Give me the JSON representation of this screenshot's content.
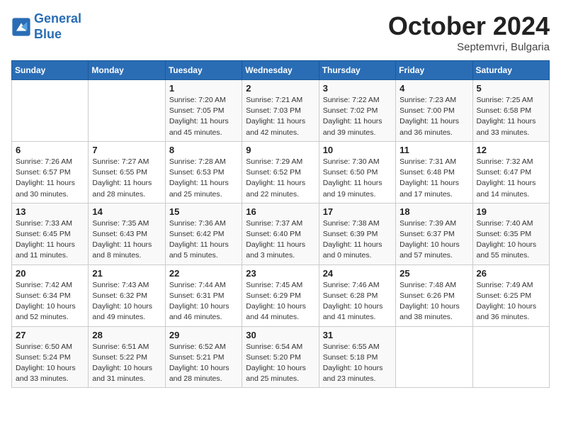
{
  "logo": {
    "line1": "General",
    "line2": "Blue"
  },
  "title": "October 2024",
  "subtitle": "Septemvri, Bulgaria",
  "weekdays": [
    "Sunday",
    "Monday",
    "Tuesday",
    "Wednesday",
    "Thursday",
    "Friday",
    "Saturday"
  ],
  "weeks": [
    [
      {
        "day": "",
        "info": ""
      },
      {
        "day": "",
        "info": ""
      },
      {
        "day": "1",
        "info": "Sunrise: 7:20 AM\nSunset: 7:05 PM\nDaylight: 11 hours and 45 minutes."
      },
      {
        "day": "2",
        "info": "Sunrise: 7:21 AM\nSunset: 7:03 PM\nDaylight: 11 hours and 42 minutes."
      },
      {
        "day": "3",
        "info": "Sunrise: 7:22 AM\nSunset: 7:02 PM\nDaylight: 11 hours and 39 minutes."
      },
      {
        "day": "4",
        "info": "Sunrise: 7:23 AM\nSunset: 7:00 PM\nDaylight: 11 hours and 36 minutes."
      },
      {
        "day": "5",
        "info": "Sunrise: 7:25 AM\nSunset: 6:58 PM\nDaylight: 11 hours and 33 minutes."
      }
    ],
    [
      {
        "day": "6",
        "info": "Sunrise: 7:26 AM\nSunset: 6:57 PM\nDaylight: 11 hours and 30 minutes."
      },
      {
        "day": "7",
        "info": "Sunrise: 7:27 AM\nSunset: 6:55 PM\nDaylight: 11 hours and 28 minutes."
      },
      {
        "day": "8",
        "info": "Sunrise: 7:28 AM\nSunset: 6:53 PM\nDaylight: 11 hours and 25 minutes."
      },
      {
        "day": "9",
        "info": "Sunrise: 7:29 AM\nSunset: 6:52 PM\nDaylight: 11 hours and 22 minutes."
      },
      {
        "day": "10",
        "info": "Sunrise: 7:30 AM\nSunset: 6:50 PM\nDaylight: 11 hours and 19 minutes."
      },
      {
        "day": "11",
        "info": "Sunrise: 7:31 AM\nSunset: 6:48 PM\nDaylight: 11 hours and 17 minutes."
      },
      {
        "day": "12",
        "info": "Sunrise: 7:32 AM\nSunset: 6:47 PM\nDaylight: 11 hours and 14 minutes."
      }
    ],
    [
      {
        "day": "13",
        "info": "Sunrise: 7:33 AM\nSunset: 6:45 PM\nDaylight: 11 hours and 11 minutes."
      },
      {
        "day": "14",
        "info": "Sunrise: 7:35 AM\nSunset: 6:43 PM\nDaylight: 11 hours and 8 minutes."
      },
      {
        "day": "15",
        "info": "Sunrise: 7:36 AM\nSunset: 6:42 PM\nDaylight: 11 hours and 5 minutes."
      },
      {
        "day": "16",
        "info": "Sunrise: 7:37 AM\nSunset: 6:40 PM\nDaylight: 11 hours and 3 minutes."
      },
      {
        "day": "17",
        "info": "Sunrise: 7:38 AM\nSunset: 6:39 PM\nDaylight: 11 hours and 0 minutes."
      },
      {
        "day": "18",
        "info": "Sunrise: 7:39 AM\nSunset: 6:37 PM\nDaylight: 10 hours and 57 minutes."
      },
      {
        "day": "19",
        "info": "Sunrise: 7:40 AM\nSunset: 6:35 PM\nDaylight: 10 hours and 55 minutes."
      }
    ],
    [
      {
        "day": "20",
        "info": "Sunrise: 7:42 AM\nSunset: 6:34 PM\nDaylight: 10 hours and 52 minutes."
      },
      {
        "day": "21",
        "info": "Sunrise: 7:43 AM\nSunset: 6:32 PM\nDaylight: 10 hours and 49 minutes."
      },
      {
        "day": "22",
        "info": "Sunrise: 7:44 AM\nSunset: 6:31 PM\nDaylight: 10 hours and 46 minutes."
      },
      {
        "day": "23",
        "info": "Sunrise: 7:45 AM\nSunset: 6:29 PM\nDaylight: 10 hours and 44 minutes."
      },
      {
        "day": "24",
        "info": "Sunrise: 7:46 AM\nSunset: 6:28 PM\nDaylight: 10 hours and 41 minutes."
      },
      {
        "day": "25",
        "info": "Sunrise: 7:48 AM\nSunset: 6:26 PM\nDaylight: 10 hours and 38 minutes."
      },
      {
        "day": "26",
        "info": "Sunrise: 7:49 AM\nSunset: 6:25 PM\nDaylight: 10 hours and 36 minutes."
      }
    ],
    [
      {
        "day": "27",
        "info": "Sunrise: 6:50 AM\nSunset: 5:24 PM\nDaylight: 10 hours and 33 minutes."
      },
      {
        "day": "28",
        "info": "Sunrise: 6:51 AM\nSunset: 5:22 PM\nDaylight: 10 hours and 31 minutes."
      },
      {
        "day": "29",
        "info": "Sunrise: 6:52 AM\nSunset: 5:21 PM\nDaylight: 10 hours and 28 minutes."
      },
      {
        "day": "30",
        "info": "Sunrise: 6:54 AM\nSunset: 5:20 PM\nDaylight: 10 hours and 25 minutes."
      },
      {
        "day": "31",
        "info": "Sunrise: 6:55 AM\nSunset: 5:18 PM\nDaylight: 10 hours and 23 minutes."
      },
      {
        "day": "",
        "info": ""
      },
      {
        "day": "",
        "info": ""
      }
    ]
  ]
}
